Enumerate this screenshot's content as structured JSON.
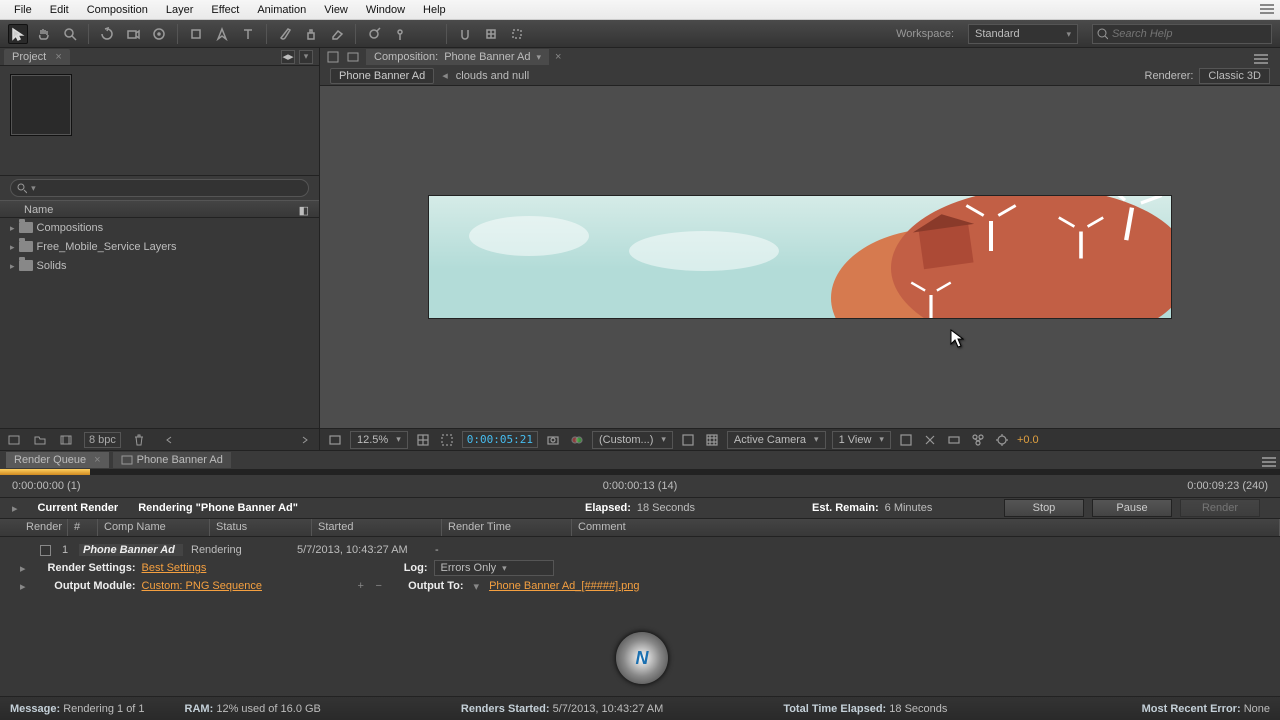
{
  "menu": {
    "items": [
      "File",
      "Edit",
      "Composition",
      "Layer",
      "Effect",
      "Animation",
      "View",
      "Window",
      "Help"
    ]
  },
  "workspace": {
    "label": "Workspace:",
    "value": "Standard",
    "search_placeholder": "Search Help"
  },
  "project": {
    "tab": "Project",
    "col_name": "Name",
    "items": [
      {
        "name": "Compositions"
      },
      {
        "name": "Free_Mobile_Service Layers"
      },
      {
        "name": "Solids"
      }
    ],
    "bpc": "8 bpc"
  },
  "composition": {
    "tab_prefix": "Composition:",
    "name": "Phone Banner Ad",
    "crumbs": [
      "Phone Banner Ad",
      "clouds and null"
    ],
    "renderer_label": "Renderer:",
    "renderer_value": "Classic 3D",
    "zoom": "12.5%",
    "timecode": "0:00:05:21",
    "color_mgmt": "(Custom...)",
    "camera": "Active Camera",
    "views": "1 View",
    "fte": "+0.0"
  },
  "render_queue": {
    "tabs": [
      "Render Queue",
      "Phone Banner Ad"
    ],
    "tc_left": "0:00:00:00 (1)",
    "tc_mid": "0:00:00:13 (14)",
    "tc_right": "0:00:09:23 (240)",
    "msg_label": "Current Render",
    "msg_text": "Rendering \"Phone Banner Ad\"",
    "elapsed_label": "Elapsed:",
    "elapsed_value": "18 Seconds",
    "est_label": "Est. Remain:",
    "est_value": "6 Minutes",
    "stop": "Stop",
    "pause": "Pause",
    "render": "Render",
    "cols": {
      "render": "Render",
      "num": "#",
      "comp": "Comp Name",
      "status": "Status",
      "started": "Started",
      "rtime": "Render Time",
      "comment": "Comment"
    },
    "item": {
      "num": "1",
      "comp": "Phone Banner Ad",
      "status": "Rendering",
      "started": "5/7/2013, 10:43:27 AM",
      "rtime": "-",
      "rs_label": "Render Settings:",
      "rs_value": "Best Settings",
      "om_label": "Output Module:",
      "om_value": "Custom: PNG Sequence",
      "log_label": "Log:",
      "log_value": "Errors Only",
      "out_label": "Output To:",
      "out_value": "Phone Banner Ad_[#####].png"
    }
  },
  "status": {
    "msg_label": "Message:",
    "msg": "Rendering 1 of 1",
    "ram_label": "RAM:",
    "ram": "12% used of 16.0 GB",
    "start_label": "Renders Started:",
    "start": "5/7/2013, 10:43:27 AM",
    "tot_label": "Total Time Elapsed:",
    "tot": "18 Seconds",
    "err_label": "Most Recent Error:",
    "err": "None"
  }
}
